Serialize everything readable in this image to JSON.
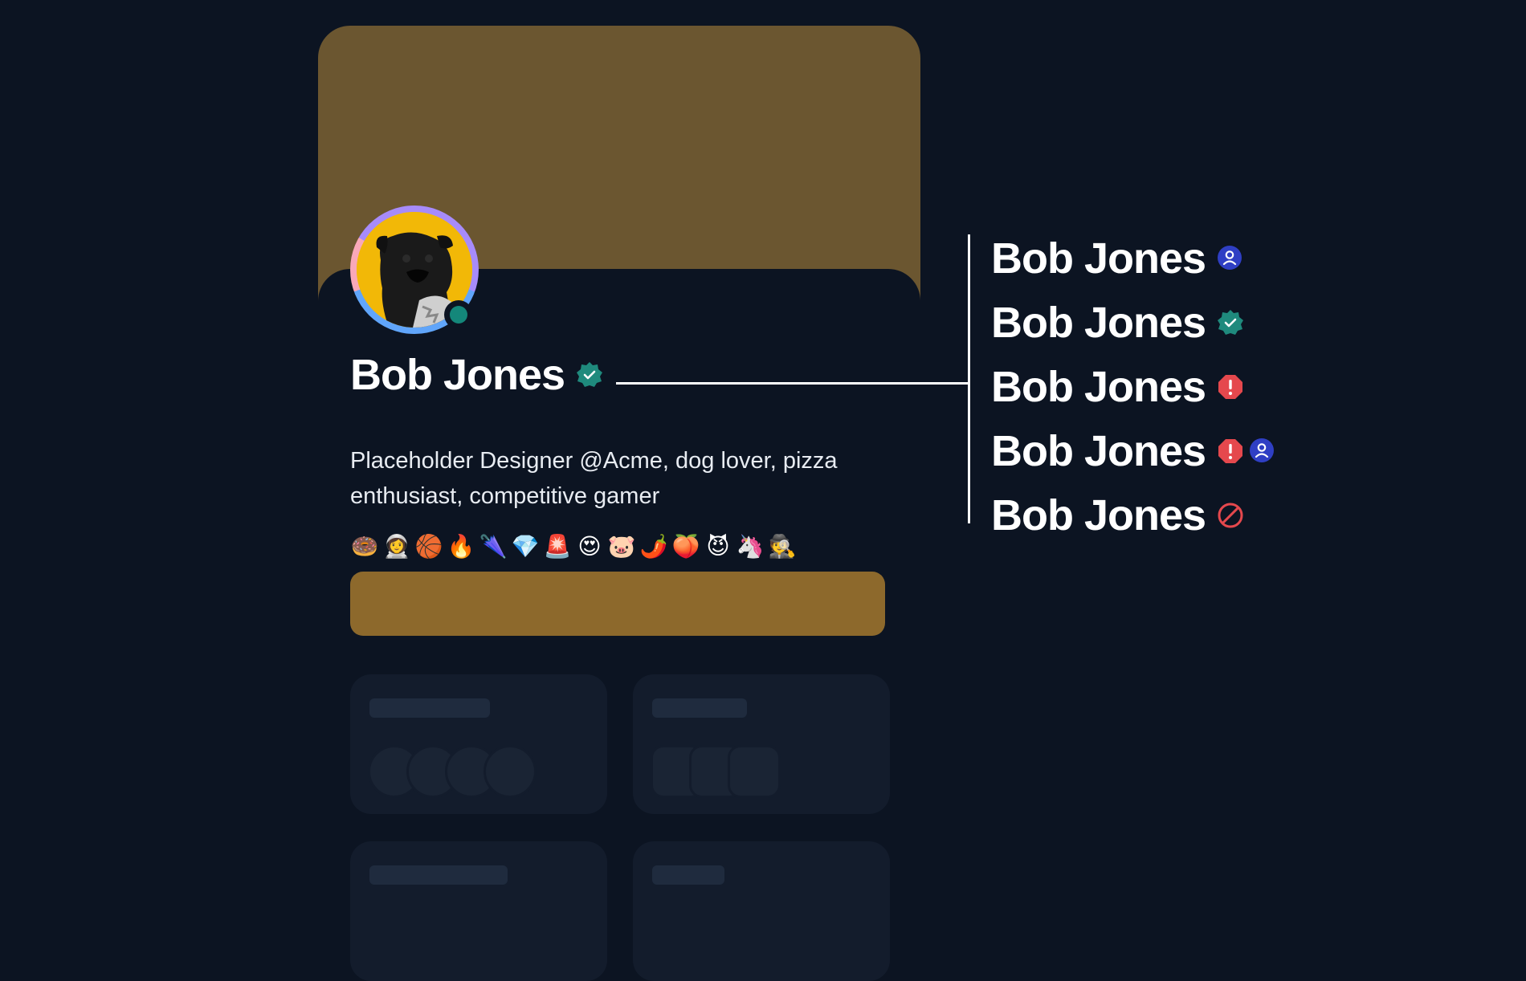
{
  "profile": {
    "name": "Bob Jones",
    "bio": "Placeholder Designer @Acme, dog lover, pizza enthusiast, competitive gamer",
    "avatar_alt": "pug-photo",
    "status": "online",
    "badge": "verified-icon",
    "emojis": [
      "🍩",
      "👩‍🚀",
      "🏀",
      "🔥",
      "🌂",
      "💎",
      "🚨",
      "😍",
      "🐷",
      "🌶️",
      "🍑",
      "😈",
      "🦄",
      "🕵️"
    ]
  },
  "variants": [
    {
      "name": "Bob Jones",
      "badges": [
        "user-badge-icon"
      ]
    },
    {
      "name": "Bob Jones",
      "badges": [
        "verified-icon"
      ]
    },
    {
      "name": "Bob Jones",
      "badges": [
        "alert-icon"
      ]
    },
    {
      "name": "Bob Jones",
      "badges": [
        "alert-icon",
        "user-badge-icon"
      ]
    },
    {
      "name": "Bob Jones",
      "badges": [
        "blocked-icon"
      ]
    }
  ],
  "colors": {
    "background": "#0c1422",
    "banner": "#6b5630",
    "button": "#8d692c",
    "verified": "#1f8a7d",
    "alert": "#e5484d",
    "user_badge": "#2f3fc4",
    "status_online": "#14877a"
  }
}
